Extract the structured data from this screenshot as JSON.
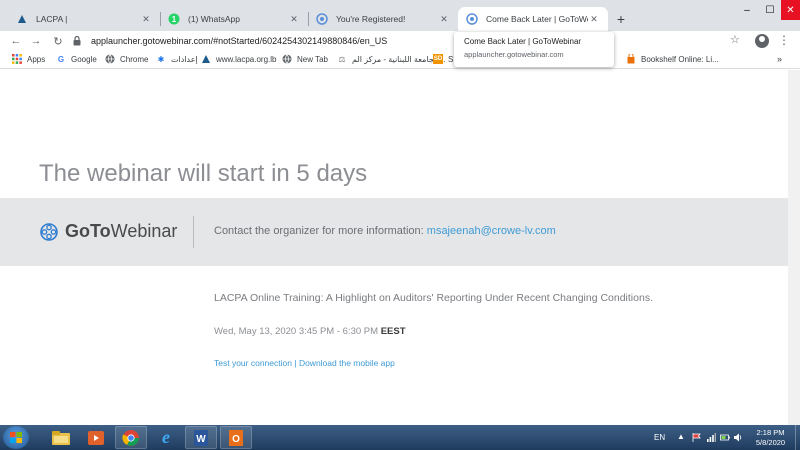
{
  "browser": {
    "tabs": [
      {
        "title": "LACPA |",
        "icon": "lacpa-logo-icon",
        "active": false
      },
      {
        "title": "(1) WhatsApp",
        "icon": "whatsapp-icon",
        "active": false
      },
      {
        "title": "You're Registered!",
        "icon": "gotowebinar-icon",
        "active": false
      },
      {
        "title": "Come Back Later | GoToWebinar",
        "icon": "gotowebinar-icon",
        "active": true
      }
    ],
    "new_tab_symbol": "+",
    "window_controls": {
      "minimize": "–",
      "maximize": "☐",
      "close": "✕"
    },
    "nav": {
      "back": "←",
      "forward": "→",
      "reload": "↻"
    },
    "url": "applauncher.gotowebinar.com/#notStarted/6024254302149880846/en_US",
    "star_symbol": "☆",
    "menu_symbol": "⋮",
    "bookmarks": [
      {
        "label": "Apps",
        "icon": "apps-grid-icon"
      },
      {
        "label": "Google",
        "icon": "google-icon"
      },
      {
        "label": "Chrome",
        "icon": "globe-icon"
      },
      {
        "label": "إعدادات",
        "icon": "settings-gear-icon"
      },
      {
        "label": "www.lacpa.org.lb",
        "icon": "lacpa-logo-icon"
      },
      {
        "label": "New Tab",
        "icon": "globe-icon"
      },
      {
        "label": "الجامعة اللبنانية - مركز الم...",
        "icon": "university-icon"
      },
      {
        "label": "S",
        "icon": "sd-icon"
      },
      {
        "label": "Bookshelf Online: Li...",
        "icon": "bookshelf-icon"
      }
    ],
    "bookmarks_more": "»",
    "tooltip": {
      "title": "Come Back Later | GoToWebinar",
      "url": "applauncher.gotowebinar.com"
    }
  },
  "page": {
    "headline": "The webinar will start in 5 days",
    "brand": {
      "go": "GoTo",
      "web": "Webinar"
    },
    "contact_label": "Contact the organizer for more information:",
    "contact_email": "msajeenah@crowe-lv.com",
    "event_title": "LACPA Online Training: A Highlight on Auditors' Reporting Under Recent Changing Conditions.",
    "event_time": "Wed, May 13, 2020 3:45 PM - 6:30 PM",
    "event_timezone": "EEST",
    "link_test": "Test your connection",
    "link_separator": "|",
    "link_download": "Download the mobile app"
  },
  "taskbar": {
    "apps": [
      {
        "name": "file-explorer-icon",
        "running": false
      },
      {
        "name": "media-player-icon",
        "running": false
      },
      {
        "name": "chrome-icon",
        "running": true
      },
      {
        "name": "internet-explorer-icon",
        "running": false
      },
      {
        "name": "word-icon",
        "running": true
      },
      {
        "name": "outlook-icon",
        "running": true
      }
    ],
    "language": "EN",
    "tray_expand": "▲",
    "time": "2:18 PM",
    "date": "5/8/2020"
  },
  "colors": {
    "tab_strip": "#dee1e6",
    "band": "#e5e6e8",
    "link": "#3e9bd6",
    "headline": "#8c8e93",
    "taskbar": "#2b4a70",
    "close_red": "#e81123"
  }
}
